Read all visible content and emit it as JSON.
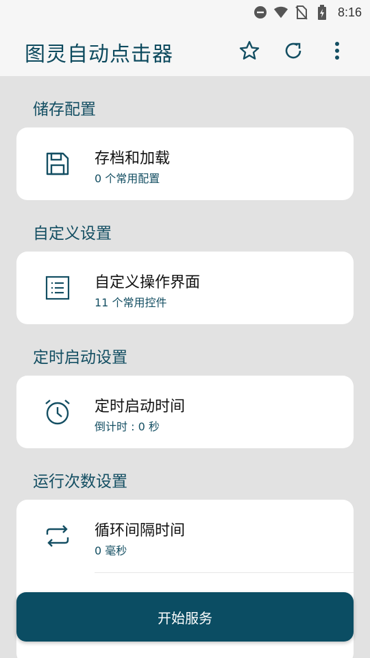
{
  "status_bar": {
    "time": "8:16",
    "icons": [
      "do-not-disturb-icon",
      "wifi-icon",
      "no-sim-icon",
      "battery-charging-icon"
    ]
  },
  "app_bar": {
    "title": "图灵自动点击器",
    "actions": [
      "star-icon",
      "refresh-icon",
      "more-vert-icon"
    ]
  },
  "sections": [
    {
      "title": "储存配置",
      "items": [
        {
          "icon": "save-icon",
          "label": "存档和加载",
          "sub": "0 个常用配置"
        }
      ]
    },
    {
      "title": "自定义设置",
      "items": [
        {
          "icon": "list-icon",
          "label": "自定义操作界面",
          "sub": "11 个常用控件"
        }
      ]
    },
    {
      "title": "定时启动设置",
      "items": [
        {
          "icon": "alarm-icon",
          "label": "定时启动时间",
          "sub": "倒计时 : 0 秒"
        }
      ]
    },
    {
      "title": "运行次数设置",
      "items": [
        {
          "icon": "repeat-icon",
          "label": "循环间隔时间",
          "sub": "0 毫秒"
        }
      ]
    }
  ],
  "start_button": {
    "label": "开始服务"
  },
  "colors": {
    "accent": "#0b4d63",
    "title": "#0d4a5e",
    "background": "#e2e2e2",
    "card": "#ffffff"
  }
}
